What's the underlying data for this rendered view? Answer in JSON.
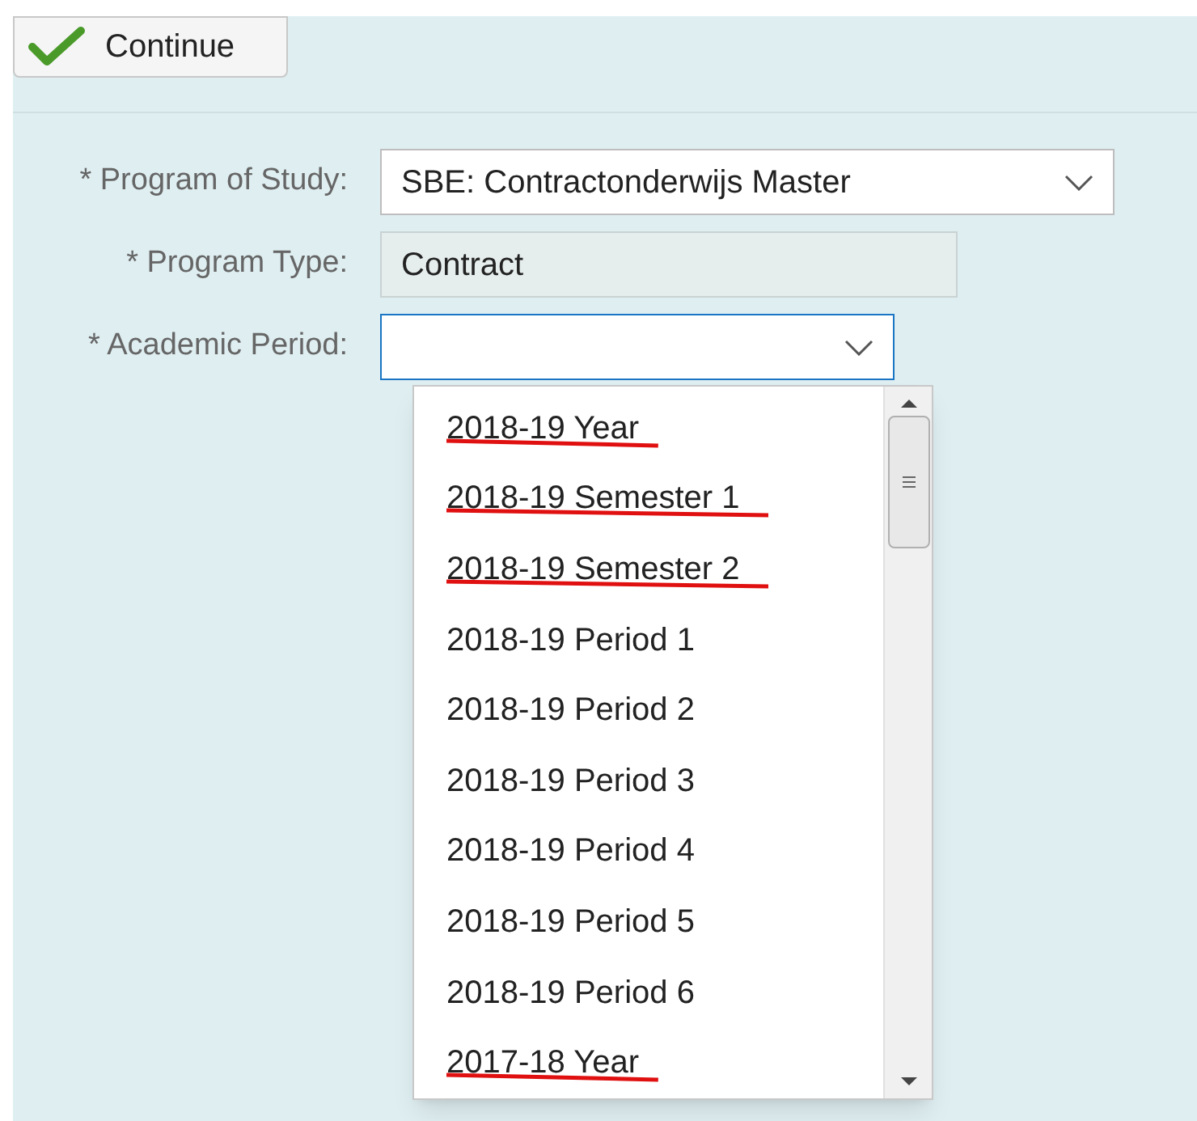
{
  "toolbar": {
    "continue_button": "Continue"
  },
  "form": {
    "fields": [
      {
        "label": "* Program of Study:",
        "kind": "dropdown",
        "value": "SBE: Contractonderwijs Master",
        "focused": false
      },
      {
        "label": "* Program Type:",
        "kind": "readonly",
        "value": "Contract",
        "focused": false
      },
      {
        "label": "* Academic Period:",
        "kind": "dropdown",
        "focused": true
      }
    ]
  },
  "dropdown_list": {
    "items": [
      {
        "label": "2018-19 Year",
        "struck": true
      },
      {
        "label": "2018-19 Semester 1",
        "struck": true
      },
      {
        "label": "2018-19 Semester 2",
        "struck": true
      },
      {
        "label": "2018-19 Period 1",
        "struck": false
      },
      {
        "label": "2018-19 Period 2",
        "struck": false
      },
      {
        "label": "2018-19 Period 3",
        "struck": false
      },
      {
        "label": "2018-19 Period 4",
        "struck": false
      },
      {
        "label": "2018-19 Period 5",
        "struck": false
      },
      {
        "label": "2018-19 Period 6",
        "struck": false
      },
      {
        "label": "2017-18 Year",
        "struck": true
      }
    ]
  }
}
